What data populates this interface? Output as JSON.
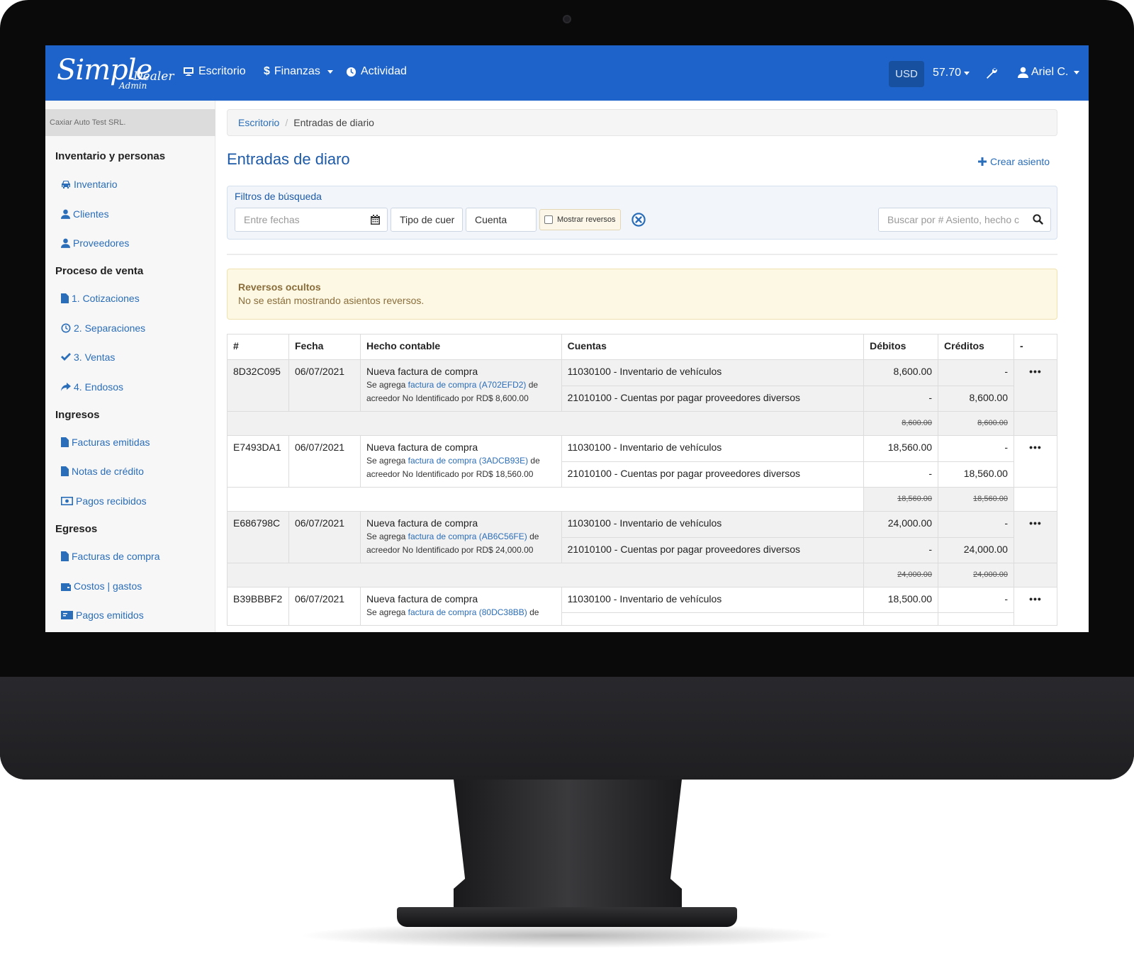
{
  "brand": {
    "main": "Simple",
    "sub": "Dealer",
    "tag": "Admin"
  },
  "nav": {
    "items": [
      {
        "label": "Escritorio",
        "icon": "monitor-icon"
      },
      {
        "label": "Finanzas",
        "icon": "dollar-icon"
      },
      {
        "label": "Actividad",
        "icon": "clock-icon"
      }
    ],
    "currency": "USD",
    "rate": "57.70",
    "user": "Ariel C."
  },
  "sidebar": {
    "company": "Caxiar Auto Test SRL.",
    "sections": [
      {
        "title": "Inventario y personas",
        "items": [
          {
            "label": "Inventario",
            "icon": "car-icon"
          },
          {
            "label": "Clientes",
            "icon": "user-icon"
          },
          {
            "label": "Proveedores",
            "icon": "user-icon"
          }
        ]
      },
      {
        "title": "Proceso de venta",
        "items": [
          {
            "label": "1. Cotizaciones",
            "icon": "file-icon"
          },
          {
            "label": "2. Separaciones",
            "icon": "clock-icon"
          },
          {
            "label": "3. Ventas",
            "icon": "check-icon"
          },
          {
            "label": "4. Endosos",
            "icon": "share-icon"
          }
        ]
      },
      {
        "title": "Ingresos",
        "items": [
          {
            "label": "Facturas emitidas",
            "icon": "file-icon"
          },
          {
            "label": "Notas de crédito",
            "icon": "file-icon"
          },
          {
            "label": "Pagos recibidos",
            "icon": "money-icon"
          }
        ]
      },
      {
        "title": "Egresos",
        "items": [
          {
            "label": "Facturas de compra",
            "icon": "file-icon"
          },
          {
            "label": "Costos | gastos",
            "icon": "wallet-icon"
          },
          {
            "label": "Pagos emitidos",
            "icon": "money-icon"
          }
        ]
      }
    ]
  },
  "breadcrumb": {
    "home": "Escritorio",
    "current": "Entradas de diario"
  },
  "page": {
    "title": "Entradas de diaro",
    "create_label": "Crear asiento"
  },
  "filters": {
    "title": "Filtros de búsqueda",
    "date_placeholder": "Entre fechas",
    "type_placeholder": "Tipo de cuer",
    "account_placeholder": "Cuenta",
    "show_reversals_label": "Mostrar reversos",
    "search_placeholder": "Buscar por # Asiento, hecho c"
  },
  "alert": {
    "title": "Reversos ocultos",
    "message": "No se están mostrando asientos reversos."
  },
  "table": {
    "headers": [
      "#",
      "Fecha",
      "Hecho contable",
      "Cuentas",
      "Débitos",
      "Créditos",
      "-"
    ],
    "rows": [
      {
        "id": "8D32C095",
        "date": "06/07/2021",
        "title": "Nueva factura de compra",
        "sub_pre": "Se agrega ",
        "sub_ref": "factura de compra (A702EFD2)",
        "sub_post": " de acreedor No Identificado por RD$ 8,600.00",
        "lines": [
          {
            "account": "11030100 - Inventario de vehículos",
            "debit": "8,600.00",
            "credit": "-"
          },
          {
            "account": "21010100 - Cuentas por pagar proveedores diversos",
            "debit": "-",
            "credit": "8,600.00"
          }
        ],
        "total_debit": "8,600.00",
        "total_credit": "8,600.00"
      },
      {
        "id": "E7493DA1",
        "date": "06/07/2021",
        "title": "Nueva factura de compra",
        "sub_pre": "Se agrega ",
        "sub_ref": "factura de compra (3ADCB93E)",
        "sub_post": " de acreedor No Identificado por RD$ 18,560.00",
        "lines": [
          {
            "account": "11030100 - Inventario de vehículos",
            "debit": "18,560.00",
            "credit": "-"
          },
          {
            "account": "21010100 - Cuentas por pagar proveedores diversos",
            "debit": "-",
            "credit": "18,560.00"
          }
        ],
        "total_debit": "18,560.00",
        "total_credit": "18,560.00"
      },
      {
        "id": "E686798C",
        "date": "06/07/2021",
        "title": "Nueva factura de compra",
        "sub_pre": "Se agrega ",
        "sub_ref": "factura de compra (AB6C56FE)",
        "sub_post": " de acreedor No Identificado por RD$ 24,000.00",
        "lines": [
          {
            "account": "11030100 - Inventario de vehículos",
            "debit": "24,000.00",
            "credit": "-"
          },
          {
            "account": "21010100 - Cuentas por pagar proveedores diversos",
            "debit": "-",
            "credit": "24,000.00"
          }
        ],
        "total_debit": "24,000.00",
        "total_credit": "24,000.00"
      },
      {
        "id": "B39BBBF2",
        "date": "06/07/2021",
        "title": "Nueva factura de compra",
        "sub_pre": "Se agrega ",
        "sub_ref": "factura de compra (80DC38BB)",
        "sub_post": " de",
        "lines": [
          {
            "account": "11030100 - Inventario de vehículos",
            "debit": "18,500.00",
            "credit": "-"
          }
        ],
        "total_debit": "",
        "total_credit": ""
      }
    ],
    "actions_label": "•••"
  },
  "colors": {
    "navbar": "#1d63c9",
    "link": "#2a6db8",
    "title": "#1d5aa8",
    "alert_bg": "#fcf8e3",
    "alert_text": "#8a6d3b"
  }
}
